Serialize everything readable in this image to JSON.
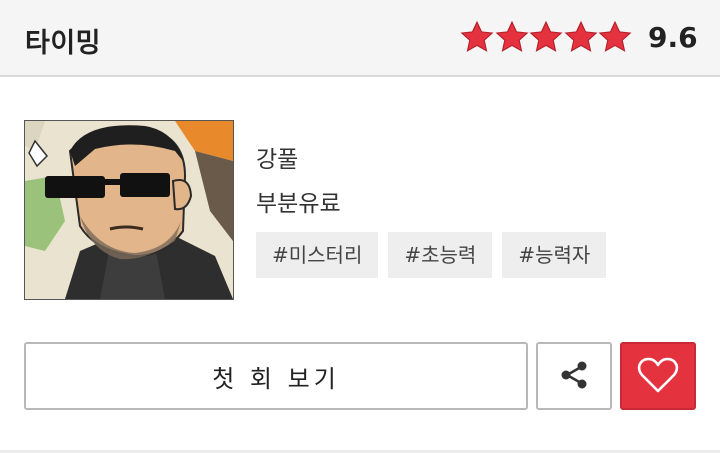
{
  "header": {
    "title": "타이밍",
    "rating": "9.6",
    "star_count": 5,
    "star_color": "#e5323f"
  },
  "work": {
    "author": "강풀",
    "pricing": "부분유료",
    "tags": [
      "#미스터리",
      "#초능력",
      "#능력자"
    ]
  },
  "actions": {
    "first_episode_label": "첫 회 보기",
    "share_icon": "share-icon",
    "like_icon": "heart-icon",
    "like_color": "#e5323f"
  }
}
